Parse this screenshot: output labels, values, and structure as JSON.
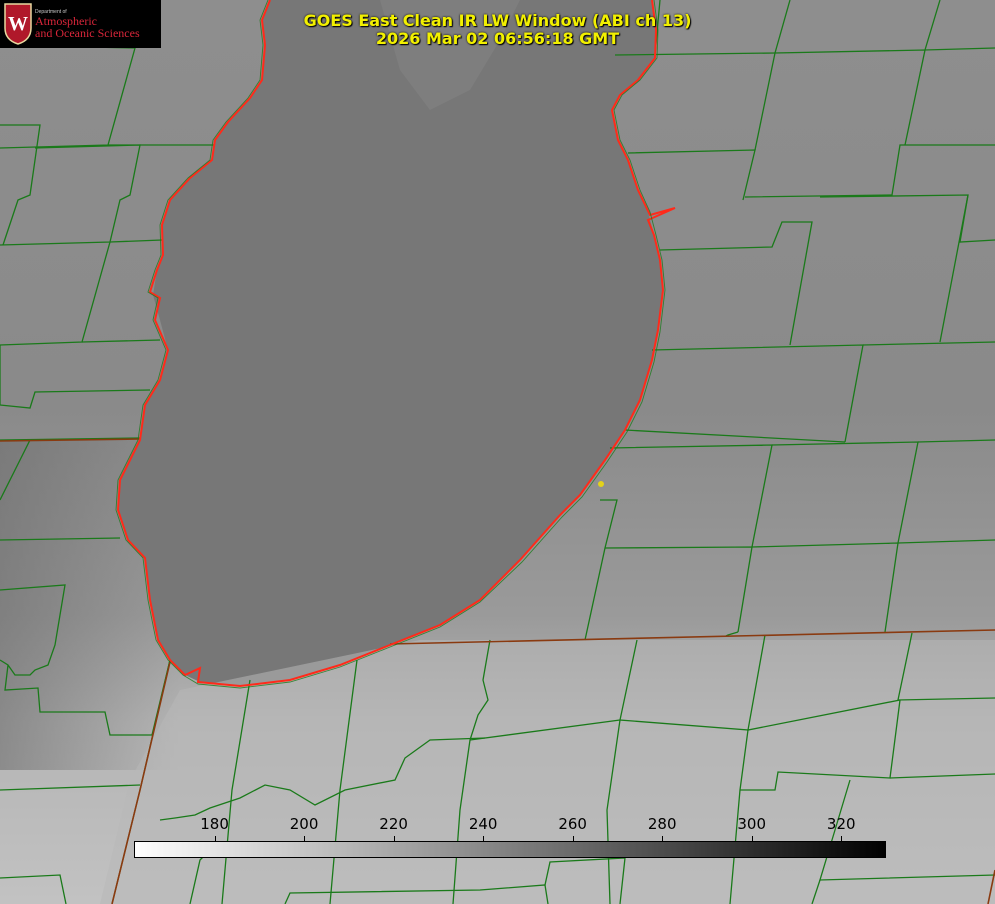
{
  "logo": {
    "department": "Department of",
    "line1": "Atmospheric",
    "line2": "and Oceanic Sciences",
    "crest_letter": "W",
    "crest_color": "#b0182a"
  },
  "title": {
    "line1": "GOES East Clean IR LW Window (ABI ch 13)",
    "line2": "2026 Mar 02 06:56:18 GMT"
  },
  "colorbar": {
    "ticks": [
      180,
      200,
      220,
      240,
      260,
      280,
      300,
      320
    ],
    "range": [
      162,
      330
    ],
    "low_color": "#ffffff",
    "high_color": "#000000"
  },
  "colors": {
    "county_lines": "#1a7a1a",
    "shoreline": "#ff2a1a",
    "state_line": "#8a3a10",
    "marker": "#e3d21a",
    "lake_fill": "#747474",
    "land_fill": "#8c8c8c",
    "clouds_fill": "#bdbdbd"
  },
  "icons": {
    "logo_crest": "uw-crest-icon",
    "marker": "yellow-dot-icon"
  }
}
